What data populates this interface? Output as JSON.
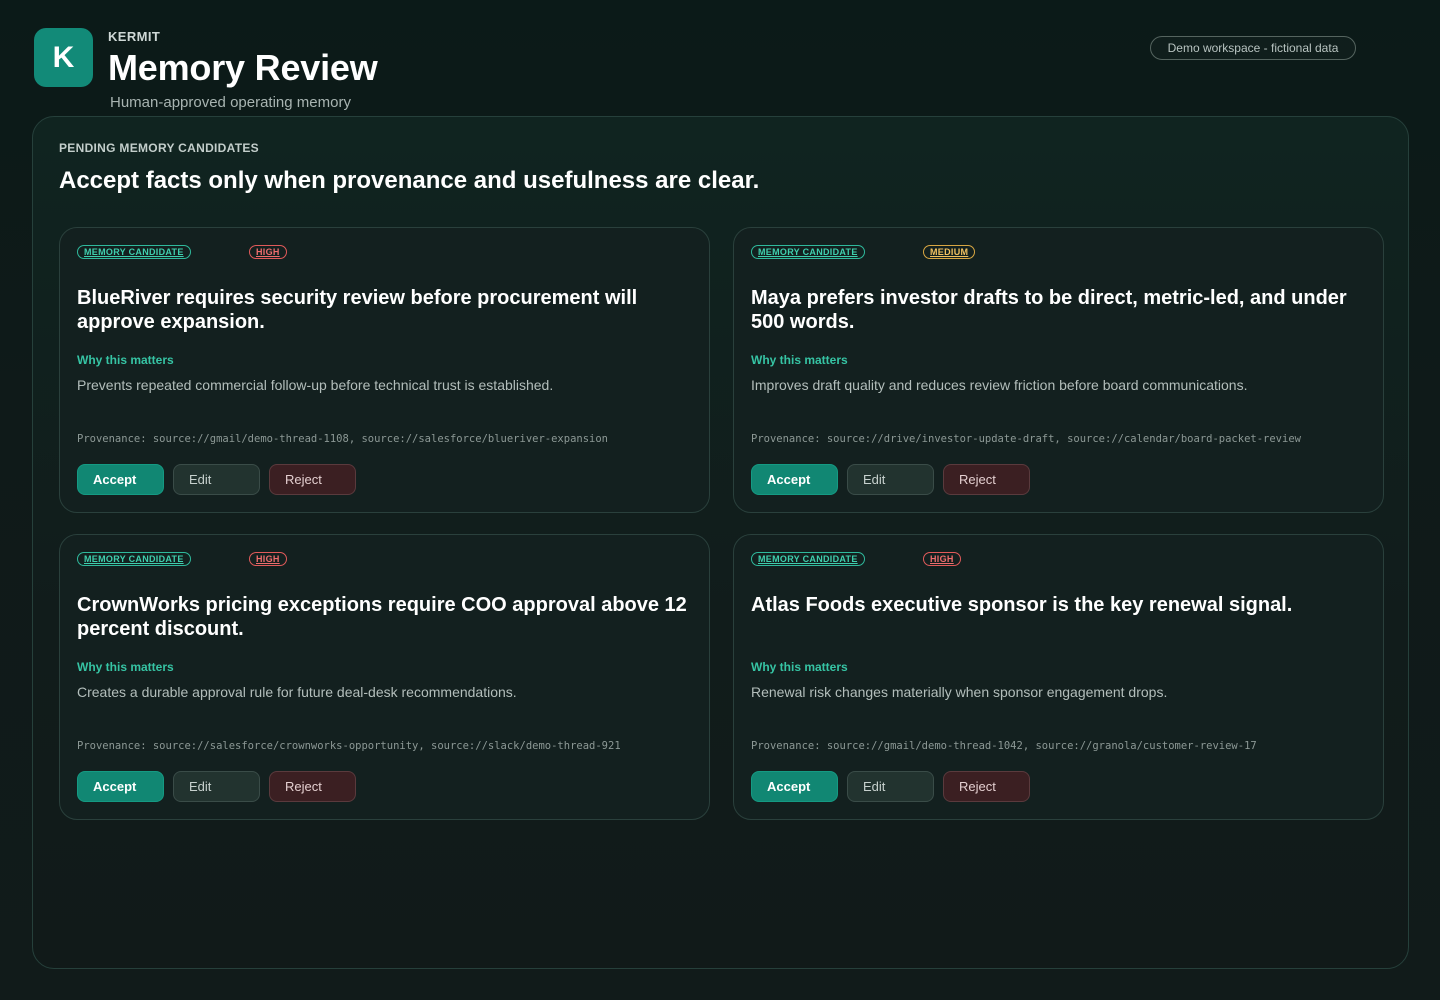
{
  "header": {
    "logo_letter": "K",
    "brand": "KERMIT",
    "title": "Memory Review",
    "subtitle": "Human-approved operating memory",
    "workspace_badge": "Demo workspace - fictional data"
  },
  "panel": {
    "kicker": "PENDING MEMORY CANDIDATES",
    "heading": "Accept facts only when provenance and usefulness are clear."
  },
  "cards": [
    {
      "tag": "MEMORY CANDIDATE",
      "priority": "HIGH",
      "title": "BlueRiver requires security review before procurement will approve expansion.",
      "why_label": "Why this matters",
      "why_text": "Prevents repeated commercial follow-up before technical trust is established.",
      "provenance": "Provenance: source://gmail/demo-thread-1108, source://salesforce/blueriver-expansion",
      "accept": "Accept",
      "edit": "Edit",
      "reject": "Reject"
    },
    {
      "tag": "MEMORY CANDIDATE",
      "priority": "MEDIUM",
      "title": "Maya prefers investor drafts to be direct, metric-led, and under 500 words.",
      "why_label": "Why this matters",
      "why_text": "Improves draft quality and reduces review friction before board communications.",
      "provenance": "Provenance: source://drive/investor-update-draft, source://calendar/board-packet-review",
      "accept": "Accept",
      "edit": "Edit",
      "reject": "Reject"
    },
    {
      "tag": "MEMORY CANDIDATE",
      "priority": "HIGH",
      "title": "CrownWorks pricing exceptions require COO approval above 12 percent discount.",
      "why_label": "Why this matters",
      "why_text": "Creates a durable approval rule for future deal-desk recommendations.",
      "provenance": "Provenance: source://salesforce/crownworks-opportunity, source://slack/demo-thread-921",
      "accept": "Accept",
      "edit": "Edit",
      "reject": "Reject"
    },
    {
      "tag": "MEMORY CANDIDATE",
      "priority": "HIGH",
      "title": "Atlas Foods executive sponsor is the key renewal signal.",
      "why_label": "Why this matters",
      "why_text": "Renewal risk changes materially when sponsor engagement drops.",
      "provenance": "Provenance: source://gmail/demo-thread-1042, source://granola/customer-review-17",
      "accept": "Accept",
      "edit": "Edit",
      "reject": "Reject"
    }
  ]
}
